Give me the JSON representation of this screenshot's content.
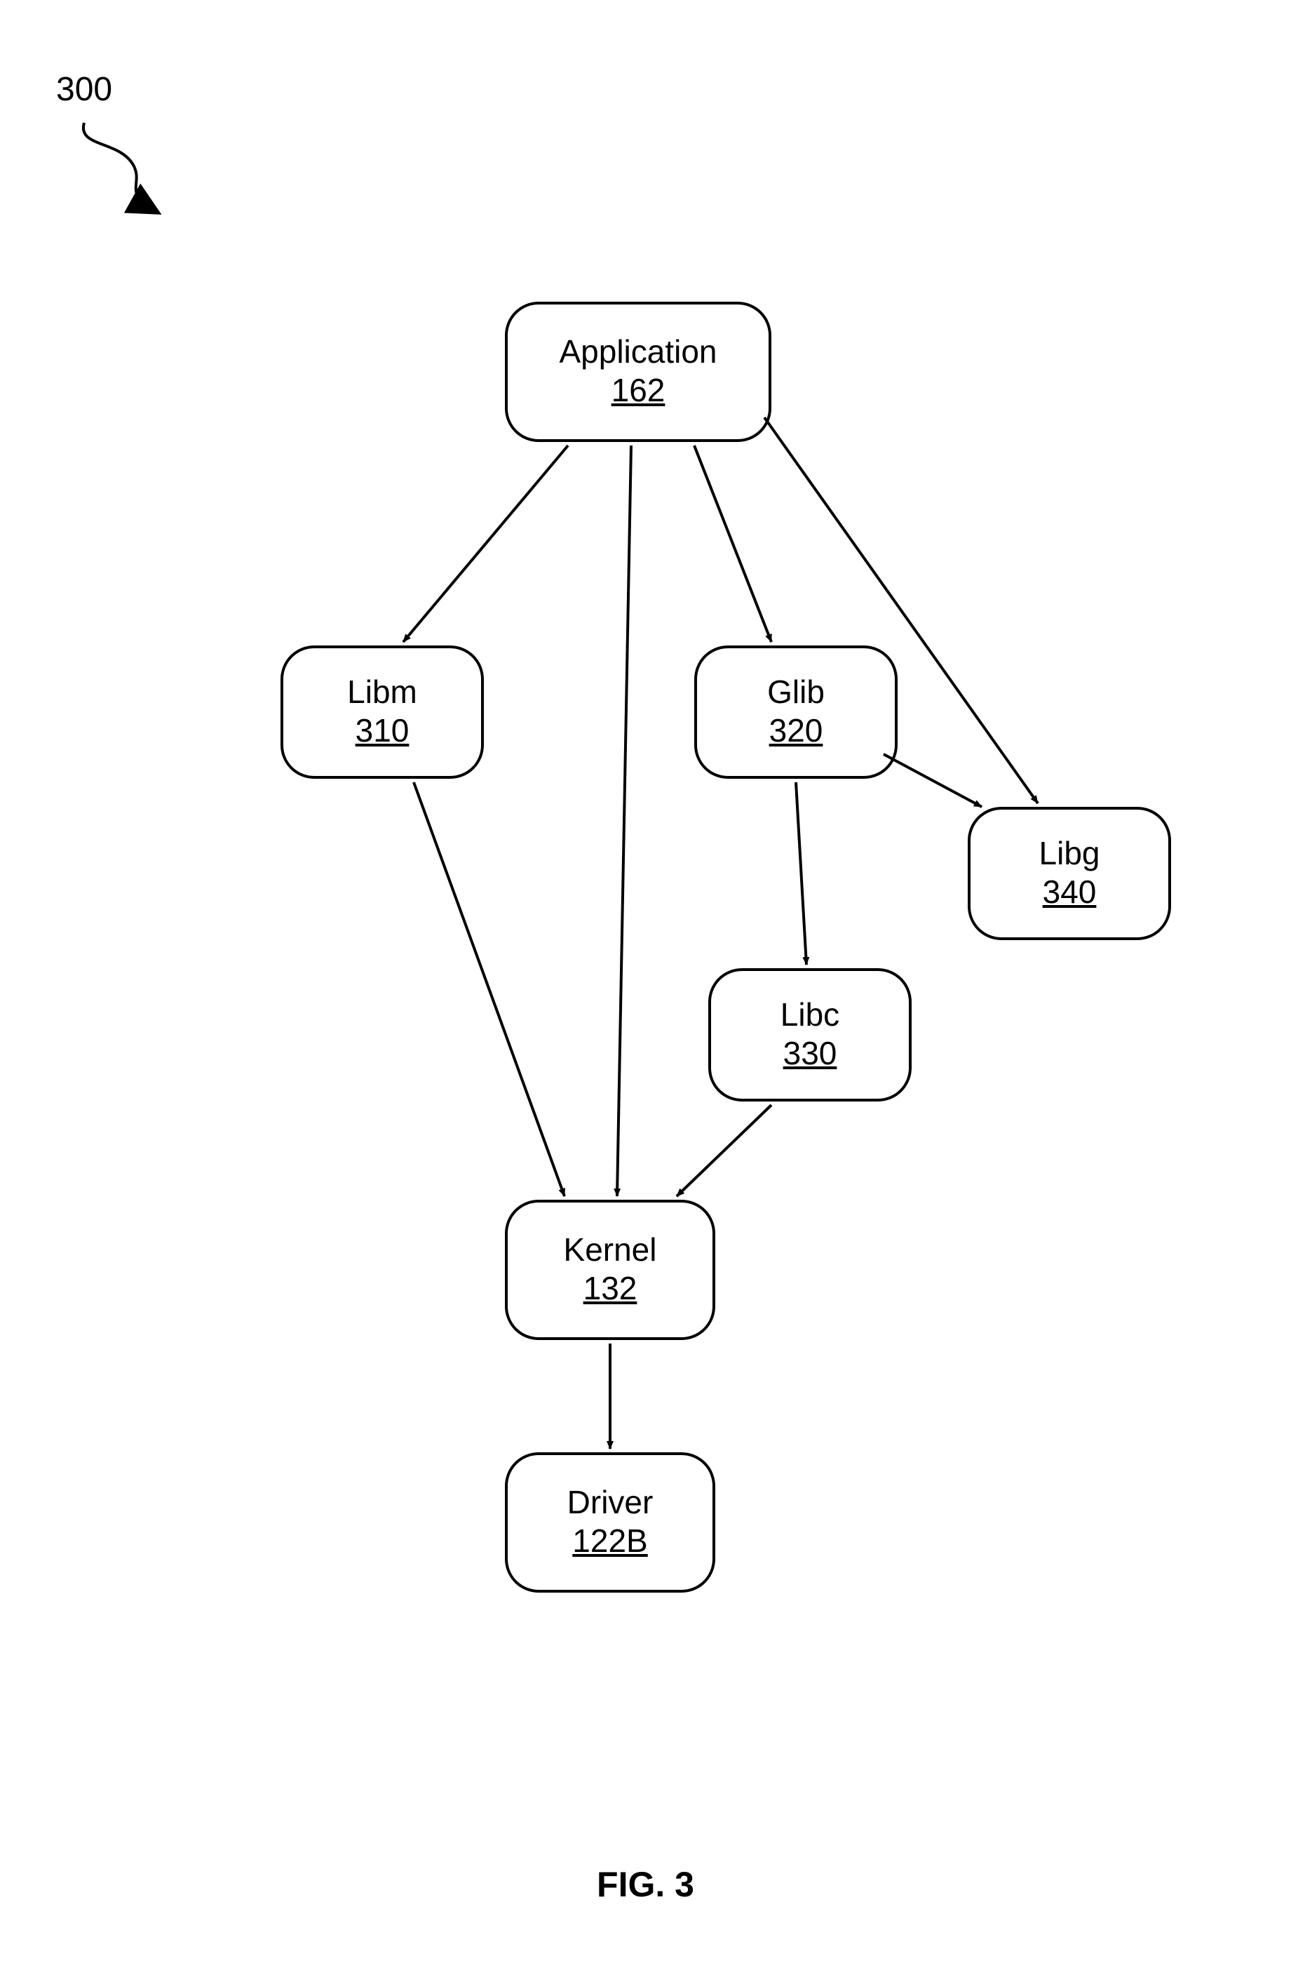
{
  "figure": {
    "ref_number": "300",
    "caption": "FIG. 3"
  },
  "nodes": {
    "application": {
      "title": "Application",
      "ref": "162"
    },
    "libm": {
      "title": "Libm",
      "ref": "310"
    },
    "glib": {
      "title": "Glib",
      "ref": "320"
    },
    "libg": {
      "title": "Libg",
      "ref": "340"
    },
    "libc": {
      "title": "Libc",
      "ref": "330"
    },
    "kernel": {
      "title": "Kernel",
      "ref": "132"
    },
    "driver": {
      "title": "Driver",
      "ref": "122B"
    }
  },
  "edges": [
    {
      "from": "application",
      "to": "libm"
    },
    {
      "from": "application",
      "to": "glib"
    },
    {
      "from": "application",
      "to": "libg"
    },
    {
      "from": "application",
      "to": "kernel"
    },
    {
      "from": "libm",
      "to": "kernel"
    },
    {
      "from": "glib",
      "to": "libc"
    },
    {
      "from": "glib",
      "to": "libg"
    },
    {
      "from": "libc",
      "to": "kernel"
    },
    {
      "from": "kernel",
      "to": "driver"
    }
  ]
}
